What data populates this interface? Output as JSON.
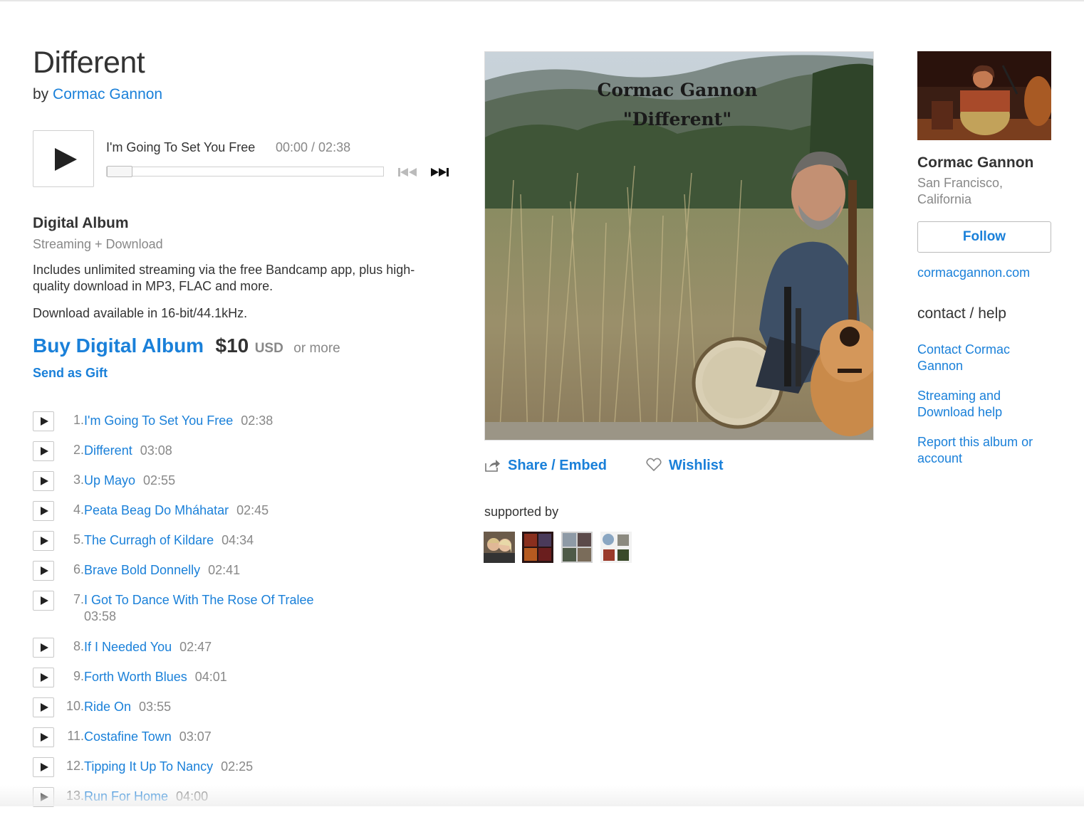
{
  "album": {
    "title": "Different",
    "by_prefix": "by",
    "artist": "Cormac Gannon"
  },
  "player": {
    "track_title": "I'm Going To Set You Free",
    "time": "00:00 / 02:38",
    "progress": 0
  },
  "digital": {
    "heading": "Digital Album",
    "subheading": "Streaming + Download",
    "description": "Includes unlimited streaming via the free Bandcamp app, plus high-quality download in MP3, FLAC and more.",
    "format": "Download available in 16-bit/44.1kHz.",
    "buy_label": "Buy Digital Album",
    "price": "$10",
    "currency": "USD",
    "or_more": "or more",
    "gift_label": "Send as Gift"
  },
  "tracks": [
    {
      "num": "1.",
      "title": "I'm Going To Set You Free",
      "length": "02:38"
    },
    {
      "num": "2.",
      "title": "Different",
      "length": "03:08"
    },
    {
      "num": "3.",
      "title": "Up Mayo",
      "length": "02:55"
    },
    {
      "num": "4.",
      "title": "Peata Beag Do Mháhatar",
      "length": "02:45"
    },
    {
      "num": "5.",
      "title": "The Curragh of Kildare",
      "length": "04:34"
    },
    {
      "num": "6.",
      "title": "Brave Bold Donnelly",
      "length": "02:41"
    },
    {
      "num": "7.",
      "title": "I Got To Dance With The Rose Of Tralee",
      "length": "03:58"
    },
    {
      "num": "8.",
      "title": "If I Needed You",
      "length": "02:47"
    },
    {
      "num": "9.",
      "title": "Forth Worth Blues",
      "length": "04:01"
    },
    {
      "num": "10.",
      "title": "Ride On",
      "length": "03:55"
    },
    {
      "num": "11.",
      "title": "Costafine Town",
      "length": "03:07"
    },
    {
      "num": "12.",
      "title": "Tipping It Up To Nancy",
      "length": "02:25"
    },
    {
      "num": "13.",
      "title": "Run For Home",
      "length": "04:00"
    }
  ],
  "cover": {
    "line1": "Cormac Gannon",
    "line2": "\"Different\""
  },
  "actions": {
    "share_label": "Share / Embed",
    "wishlist_label": "Wishlist",
    "share_icon": "share-icon",
    "wishlist_icon": "heart-icon"
  },
  "supported_by": {
    "label": "supported by",
    "count": 4
  },
  "artist_panel": {
    "name": "Cormac Gannon",
    "location": "San Francisco, California",
    "follow_label": "Follow",
    "website": "cormacgannon.com",
    "contact_heading": "contact / help",
    "links": [
      "Contact Cormac Gannon",
      "Streaming and Download help",
      "Report this album or account"
    ]
  },
  "colors": {
    "link": "#1a80d9",
    "text": "#333333",
    "muted": "#888888"
  }
}
